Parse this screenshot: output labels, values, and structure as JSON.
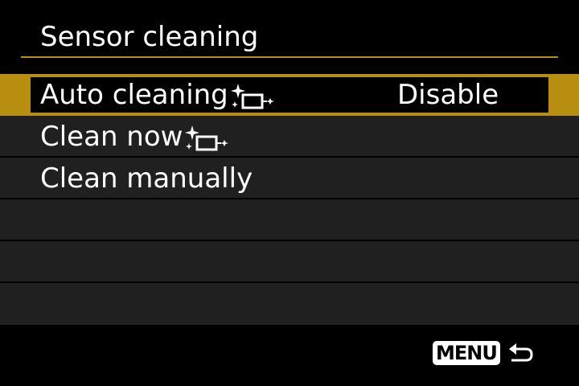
{
  "screen": {
    "title": "Sensor cleaning"
  },
  "menu": {
    "items": [
      {
        "label": "Auto cleaning",
        "value": "Disable",
        "icon": "sensor-clean-icon",
        "selected": true
      },
      {
        "label": "Clean now",
        "value": "",
        "icon": "sensor-clean-icon",
        "selected": false
      },
      {
        "label": "Clean manually",
        "value": "",
        "icon": "",
        "selected": false
      }
    ]
  },
  "footer": {
    "menu_button_label": "MENU",
    "return_icon": "return-arrow-icon"
  },
  "colors": {
    "accent": "#b88e10",
    "row_background": "#202020",
    "background": "#000000",
    "text": "#ffffff"
  }
}
